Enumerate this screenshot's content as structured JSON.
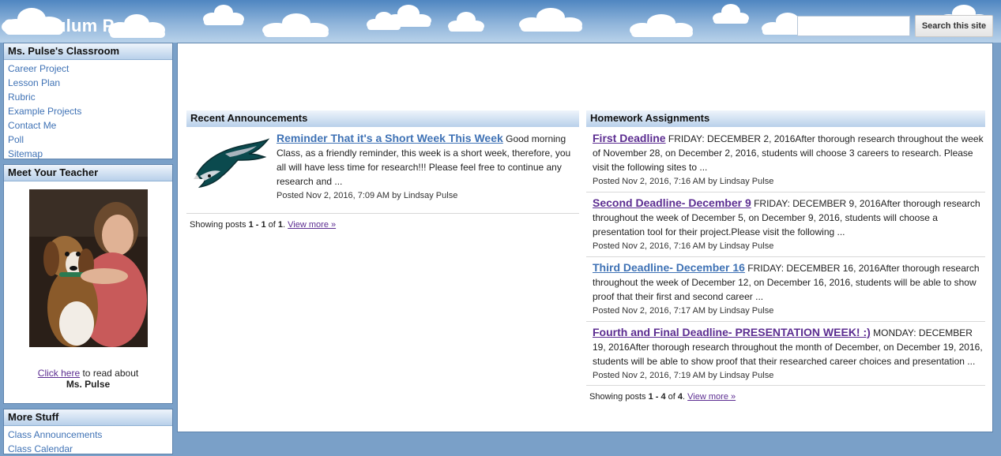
{
  "header": {
    "site_title": "Curriculum Page",
    "search_placeholder": "",
    "search_button": "Search this site"
  },
  "sidebar": {
    "classroom": {
      "title": "Ms. Pulse's Classroom",
      "items": [
        "Career Project",
        "Lesson Plan",
        "Rubric",
        "Example Projects",
        "Contact Me",
        "Poll",
        "Sitemap"
      ]
    },
    "teacher": {
      "title": "Meet Your Teacher",
      "link_text": "Click here",
      "caption_rest": " to read about",
      "name": "Ms. Pulse"
    },
    "more": {
      "title": "More Stuff",
      "items": [
        "Class Announcements",
        "Class Calendar"
      ]
    }
  },
  "announcements": {
    "title": "Recent Announcements",
    "posts": [
      {
        "title": "Reminder That it's a Short Week This Week",
        "body": " Good morning Class, as a friendly reminder, this week is a short week, therefore, you all will have less time for research!!! Please feel free to continue any research and ...",
        "meta": "Posted Nov 2, 2016, 7:09 AM by Lindsay Pulse"
      }
    ],
    "showing_prefix": "Showing posts ",
    "showing_range": "1 - 1",
    "showing_of": " of ",
    "showing_total": "1",
    "showing_dot": ". ",
    "view_more": "View more »"
  },
  "homework": {
    "title": "Homework Assignments",
    "posts": [
      {
        "title": "First Deadline",
        "body": " FRIDAY: DECEMBER 2, 2016After thorough research throughout the week of November 28, on December 2, 2016, students will choose 3 careers to research. Please visit the following sites to ...",
        "meta": "Posted Nov 2, 2016, 7:16 AM by Lindsay Pulse",
        "color": "#5c2d91"
      },
      {
        "title": "Second Deadline- December 9",
        "body": " FRIDAY: DECEMBER 9, 2016After thorough research throughout the week of December 5, on December 9, 2016, students will choose a presentation tool for their project.Please visit the following ...",
        "meta": "Posted Nov 2, 2016, 7:16 AM by Lindsay Pulse",
        "color": "#5c2d91"
      },
      {
        "title": "Third Deadline- December 16",
        "body": " FRIDAY: DECEMBER 16, 2016After thorough research throughout the week of December 12, on December 16, 2016, students will be able to show proof that their first and second career ...",
        "meta": "Posted Nov 2, 2016, 7:17 AM by Lindsay Pulse",
        "color": "#3f72b5"
      },
      {
        "title": "Fourth and Final Deadline- PRESENTATION WEEK! :)",
        "body": " MONDAY: DECEMBER 19, 2016After thorough research throughout the month of December, on December 19, 2016, students will be able to show proof that their researched career choices and presentation ...",
        "meta": "Posted Nov 2, 2016, 7:19 AM by Lindsay Pulse",
        "color": "#5c2d91"
      }
    ],
    "showing_prefix": "Showing posts ",
    "showing_range": "1 - 4",
    "showing_of": " of ",
    "showing_total": "4",
    "showing_dot": ". ",
    "view_more": "View more »"
  },
  "colors": {
    "link_blue": "#3f72b5",
    "visited_purple": "#5c2d91",
    "page_background": "#7aa0c8"
  },
  "icons": {
    "logo": "eagle-logo"
  }
}
